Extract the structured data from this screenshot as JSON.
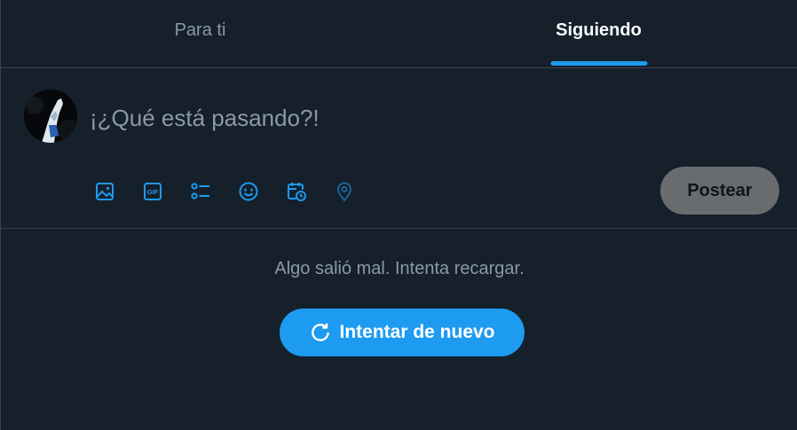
{
  "tabs": [
    {
      "label": "Para ti",
      "active": false
    },
    {
      "label": "Siguiendo",
      "active": true
    }
  ],
  "composer": {
    "placeholder": "¡¿Qué está pasando?!",
    "tools": [
      "image-icon",
      "gif-icon",
      "poll-icon",
      "emoji-icon",
      "schedule-icon",
      "location-icon"
    ],
    "post_label": "Postear"
  },
  "error": {
    "message": "Algo salió mal. Intenta recargar.",
    "retry_label": "Intentar de nuevo"
  },
  "colors": {
    "background": "#15202b",
    "accent": "#1d9bf0",
    "border": "#38444d",
    "muted_text": "#8b98a5"
  }
}
